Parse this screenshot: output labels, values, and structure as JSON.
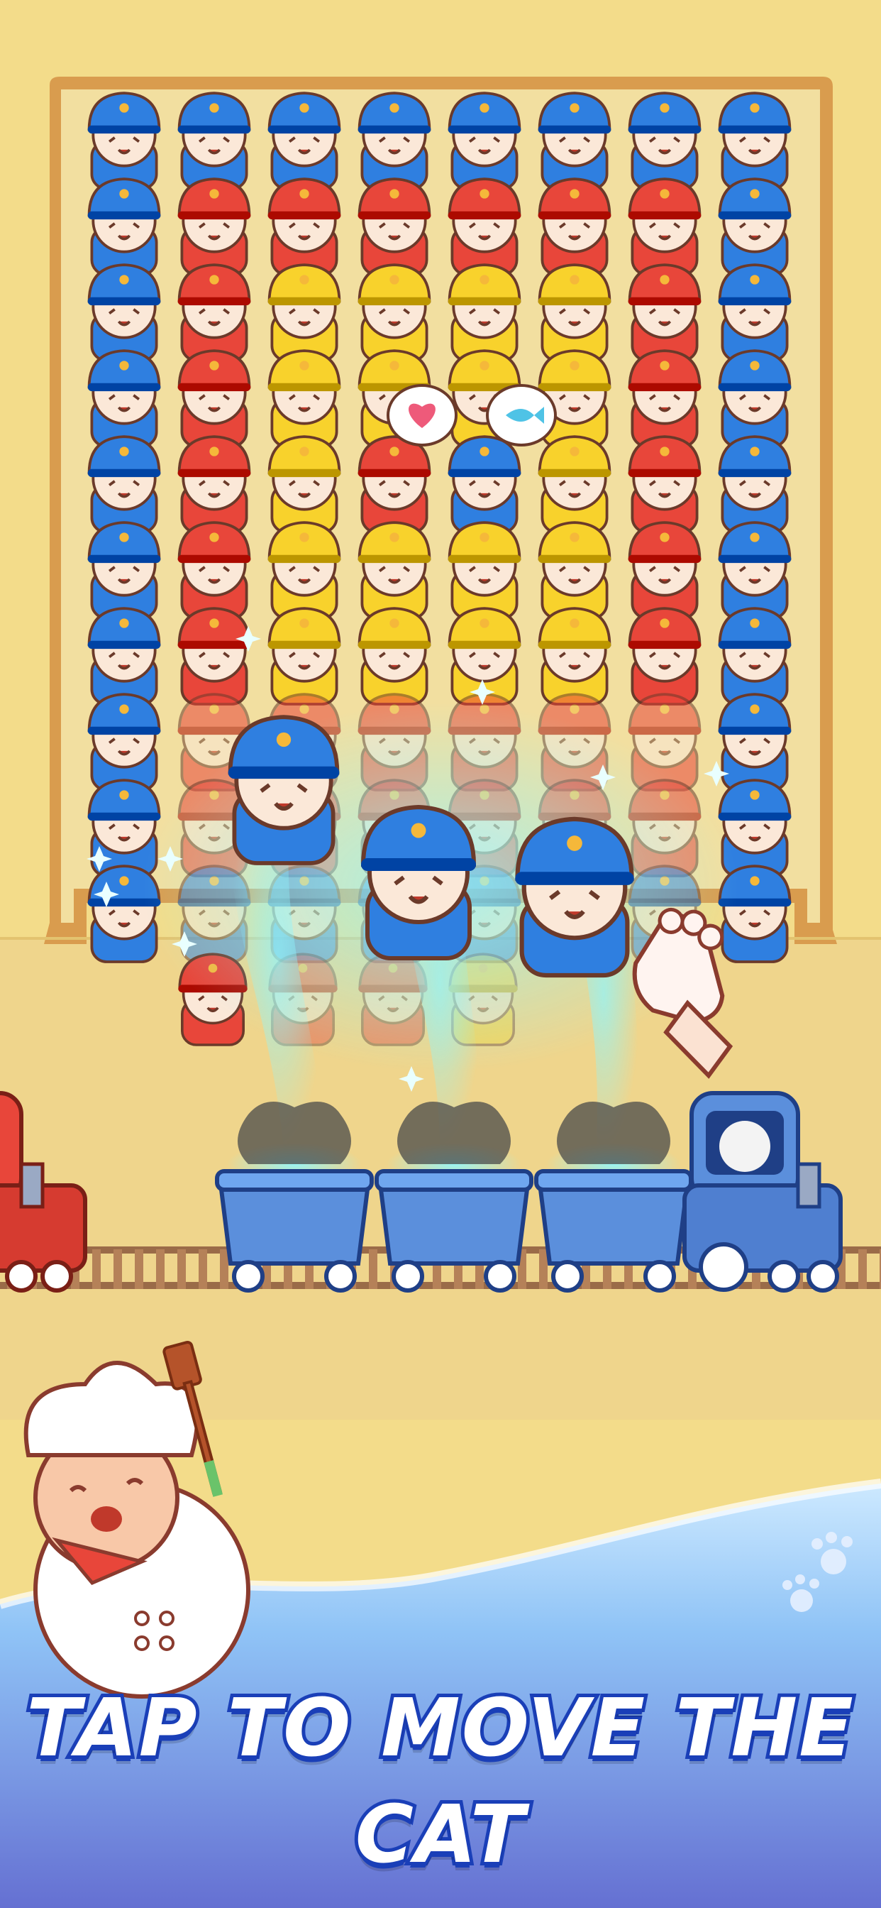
{
  "game": {
    "caption": "TAP TO MOVE THE CAT"
  },
  "board": {
    "rows": 10,
    "cols": 8,
    "grid": [
      [
        "blue",
        "blue",
        "blue",
        "blue",
        "blue",
        "blue",
        "blue",
        "blue"
      ],
      [
        "blue",
        "red",
        "red",
        "red",
        "red",
        "red",
        "red",
        "blue"
      ],
      [
        "blue",
        "red",
        "yellow",
        "yellow",
        "yellow",
        "yellow",
        "red",
        "blue"
      ],
      [
        "blue",
        "red",
        "yellow",
        "yellow",
        "yellow",
        "yellow",
        "red",
        "blue"
      ],
      [
        "blue",
        "red",
        "yellow",
        "red",
        "blue",
        "yellow",
        "red",
        "blue"
      ],
      [
        "blue",
        "red",
        "yellow",
        "yellow",
        "yellow",
        "yellow",
        "red",
        "blue"
      ],
      [
        "blue",
        "red",
        "yellow",
        "yellow",
        "yellow",
        "yellow",
        "red",
        "blue"
      ],
      [
        "blue",
        "red",
        "red",
        "red",
        "red",
        "red",
        "red",
        "blue"
      ],
      [
        "blue",
        "red",
        "red",
        "red",
        "red",
        "red",
        "red",
        "blue"
      ],
      [
        "blue",
        "blue",
        "blue",
        "blue",
        "blue",
        "blue",
        "blue",
        "blue"
      ]
    ]
  },
  "lower_row": [
    "red",
    "red",
    "red",
    "yellow"
  ],
  "bubbles": [
    "heart-icon",
    "fish-icon"
  ],
  "flying_cats": [
    "police",
    "police",
    "police"
  ],
  "train": {
    "wagons": 3,
    "engine": "blue",
    "other_engine": "red"
  },
  "colors": {
    "blue": "#2f7fe0",
    "red": "#e8463a",
    "yellow": "#f8d22c",
    "sand": "#f3dc8a",
    "board": "#f2dfa0",
    "border": "#d99c4e",
    "sea_top": "#bfe1ff",
    "sea_bottom": "#6b78d6",
    "caption_stroke": "#1a3fb8"
  }
}
